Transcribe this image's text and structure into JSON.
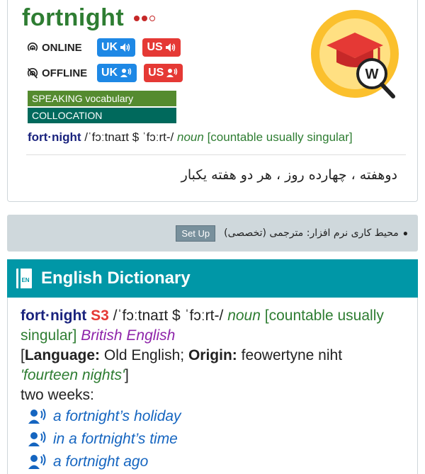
{
  "headword": "fortnight",
  "modes": {
    "online_label": "ONLINE",
    "offline_label": "OFFLINE"
  },
  "buttons": {
    "uk": "UK",
    "us": "US"
  },
  "tags": {
    "speaking": "SPEAKING vocabulary",
    "collocation": "COLLOCATION"
  },
  "entry": {
    "hw_syllabified": "fort·night",
    "ipa": "/ˈfɔːtnaɪt $ ˈfɔːrt-/",
    "pos": "noun",
    "grammar": "[countable usually singular]"
  },
  "persian_translation": "دوهفته ، چهارده روز ، هر دو هفته يكبار",
  "setup_bar": {
    "text": "محیط کاری نرم افزار: مترجمی (تخصصی)",
    "button": "Set Up"
  },
  "dictionary": {
    "title": "English Dictionary",
    "book_label": "EN",
    "hw": "fort·night",
    "level": "S3",
    "ipa": "/ˈfɔːtnaɪt $ ˈfɔːrt-/",
    "pos": "noun",
    "grammar": "[countable usually singular]",
    "region": "British English",
    "etym_language_label": "Language:",
    "etym_language": "Old English;",
    "etym_origin_label": "Origin:",
    "etym_origin": "feowertyne niht",
    "etym_gloss": "'fourteen nights'",
    "definition": "two weeks:",
    "examples": [
      "a fortnight’s holiday",
      "in a fortnight’s time",
      "a fortnight ago"
    ]
  },
  "colors": {
    "headword": "#2e7d32",
    "uk_button": "#1e88e5",
    "us_button": "#e53935",
    "dict_header": "#0097a7"
  }
}
